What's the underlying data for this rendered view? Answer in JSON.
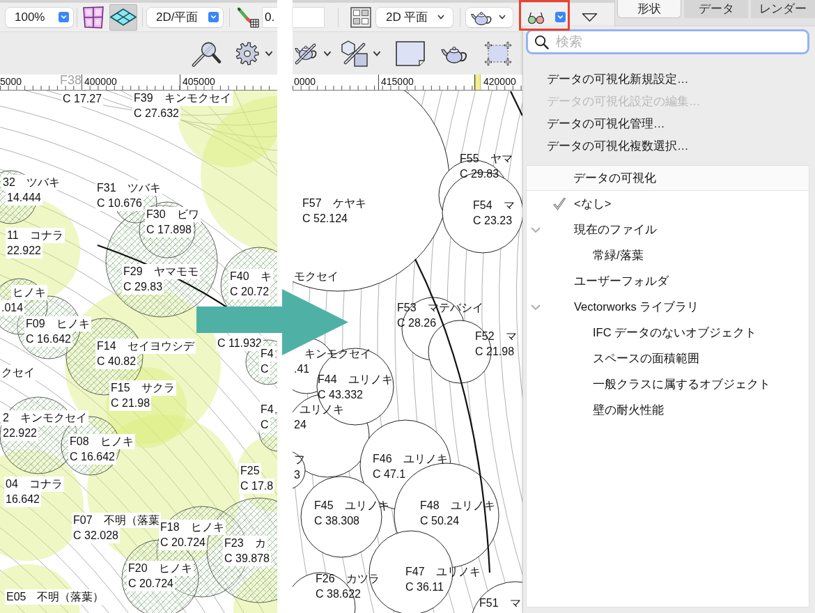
{
  "left_window": {
    "toolbar": {
      "zoom": "100%",
      "view_buttons": [
        {
          "kind": "panes",
          "selected": false
        },
        {
          "kind": "grid",
          "selected": true
        }
      ],
      "view": "2D/平面",
      "field": "0."
    },
    "ruler": {
      "labels": [
        "5000",
        "400000",
        "405000"
      ],
      "faint_text": "F38"
    },
    "labels": [
      {
        "size": "C 17.27"
      },
      {
        "name": "F39　キンモクセイ",
        "size": "C 27.632"
      },
      {
        "name": "32　ツバキ",
        "size": "14.444"
      },
      {
        "name": "F31　ツバキ",
        "size": "C 10.676"
      },
      {
        "name": "F30　ビワ",
        "size": "C 17.898"
      },
      {
        "name": "11　コナラ",
        "size": "22.922"
      },
      {
        "name": "F29　ヤマモモ",
        "size": "C 29.83"
      },
      {
        "name": "F40　キ",
        "size": "C 20.72"
      },
      {
        "name": "ヒノキ",
        "size": ".014"
      },
      {
        "name": "F09　ヒノキ",
        "size": "C 16.642"
      },
      {
        "name": "F14　セイヨウシデ",
        "size": "C 40.82"
      },
      {
        "size": "C 11.932"
      },
      {
        "name": "クセイ"
      },
      {
        "name": "F4",
        "size": "C"
      },
      {
        "name": "F15　サクラ",
        "size": "C 21.98"
      },
      {
        "name": "2　キンモクセイ",
        "size": "22.922"
      },
      {
        "name": "F4",
        "size": "C"
      },
      {
        "name": "F08　ヒノキ",
        "size": "C 16.642"
      },
      {
        "name": "F25",
        "size": "C 17.8"
      },
      {
        "name": "04　コナラ",
        "size": "16.642"
      },
      {
        "name": "F07　不明（落葉",
        "size": "C 32.028"
      },
      {
        "name": "F18　ヒノキ",
        "size": "C 20.724"
      },
      {
        "name": "F23　カ",
        "size": "C 39.878"
      },
      {
        "name": "F20　ヒノキ",
        "size": "C 20.724"
      },
      {
        "name": "E05　不明（落葉）"
      }
    ]
  },
  "right_window": {
    "toolbar": {
      "view": "2D 平面"
    },
    "ruler": {
      "labels": [
        "0000",
        "415000",
        "420000"
      ]
    },
    "labels": [
      {
        "name": "F57　ケヤキ",
        "size": "C 52.124"
      },
      {
        "name": "F55　ヤマ",
        "size": "C 29.83"
      },
      {
        "name": "F54　マ",
        "size": "C 23.23"
      },
      {
        "name": "モクセイ"
      },
      {
        "name": "F53　マテバシイ",
        "size": "C 28.26"
      },
      {
        "name": "F52　マ",
        "size": "C 21.98"
      },
      {
        "name": "キンモクセイ",
        "size": ".41"
      },
      {
        "name": "F44　ユリノキ",
        "size": "C 43.332"
      },
      {
        "name": "ユリノキ",
        "size": "24"
      },
      {
        "name": "フ",
        "size": "3"
      },
      {
        "name": "F46　ユリノキ",
        "size": "C 47.1"
      },
      {
        "name": "F45　ユリノキ",
        "size": "C 38.308"
      },
      {
        "name": "F48　ユリノキ",
        "size": "C 50.24"
      },
      {
        "name": "F47　ユリノキ",
        "size": "C 36.11"
      },
      {
        "name": "F26　カツラ",
        "size": "C 38.622"
      },
      {
        "name": "F51　マ"
      }
    ]
  },
  "palette_tabs": [
    {
      "label": "形状",
      "selected": true
    },
    {
      "label": "データ",
      "selected": false
    },
    {
      "label": "レンダー",
      "selected": false
    }
  ],
  "visualization_menu": {
    "search": {
      "placeholder": "検索"
    },
    "commands": [
      {
        "label": "データの可視化新規設定…",
        "disabled": false
      },
      {
        "label": "データの可視化設定の編集…",
        "disabled": true
      },
      {
        "label": "データの可視化管理…",
        "disabled": false
      },
      {
        "label": "データの可視化複数選択…",
        "disabled": false
      }
    ],
    "list": {
      "header": "データの可視化",
      "items": [
        {
          "label": "<なし>",
          "checked": true
        },
        {
          "label": "現在のファイル",
          "checked": false,
          "expanded": true,
          "children": [
            {
              "label": "常緑/落葉",
              "checked": false
            }
          ]
        },
        {
          "label": "ユーザーフォルダ",
          "checked": false
        },
        {
          "label": "Vectorworks ライブラリ",
          "checked": false,
          "expanded": true,
          "children": [
            {
              "label": "IFC データのないオブジェクト",
              "checked": false
            },
            {
              "label": "スペースの面積範囲",
              "checked": false
            },
            {
              "label": "一般クラスに属するオブジェクト",
              "checked": false
            },
            {
              "label": "壁の耐火性能",
              "checked": false
            }
          ]
        }
      ]
    }
  }
}
